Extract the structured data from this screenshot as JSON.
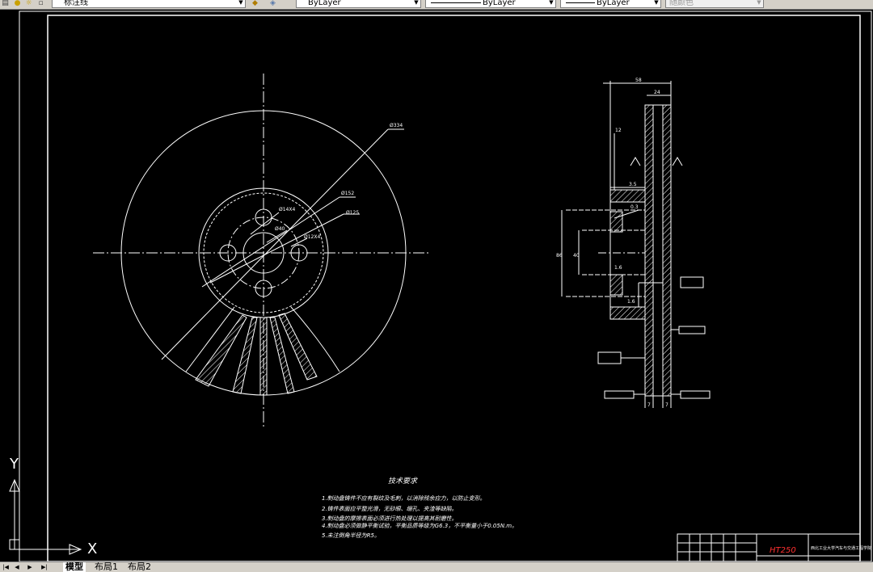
{
  "toolbar": {
    "linetype_combo": "标注线",
    "color_combo": "ByLayer",
    "linetype_combo2": "ByLayer",
    "lineweight_combo": "ByLayer",
    "plotstyle_combo": "随颜色"
  },
  "drawing": {
    "dims": {
      "d334": "Ø334",
      "d152": "Ø152",
      "d125": "Ø125",
      "bolt_holes": "Ø14X4",
      "d40": "Ø40",
      "d12x4": "Ø12X4",
      "top_58": "58",
      "top_24": "24",
      "dim_12": "12",
      "dim_3_5": "3.5",
      "dim_0_3": "0.3",
      "dim_86": "86",
      "dim_40": "40",
      "dim_r1_6": "1.6",
      "dim_r1_6b": "1.6",
      "dim_7a": "7",
      "dim_7b": "7"
    },
    "tech_title": "技术要求",
    "tech_items": [
      "1.制动盘铸件不应有裂纹及毛刺，以消除残余应力，以防止变形。",
      "2.铸件表面应平整光滑，无砂眼、缩孔、夹渣等缺陷。",
      "3.制动盘的摩擦表面必须进行热处理以提高其耐磨性。",
      "4.制动盘必须做静平衡试验，平衡品质等级为G6.3，不平衡量小于0.05N.m。",
      "5.未注倒角半径为R5。"
    ],
    "material": "HT250",
    "school": "西北工业大学汽车与交通工程学院"
  },
  "ucs": {
    "x_label": "X",
    "y_label": "Y"
  },
  "tabs": {
    "nav": [
      "|◀",
      "◀",
      "▶",
      "▶|"
    ],
    "model": "模型",
    "layout1": "布局1",
    "layout2": "布局2"
  }
}
